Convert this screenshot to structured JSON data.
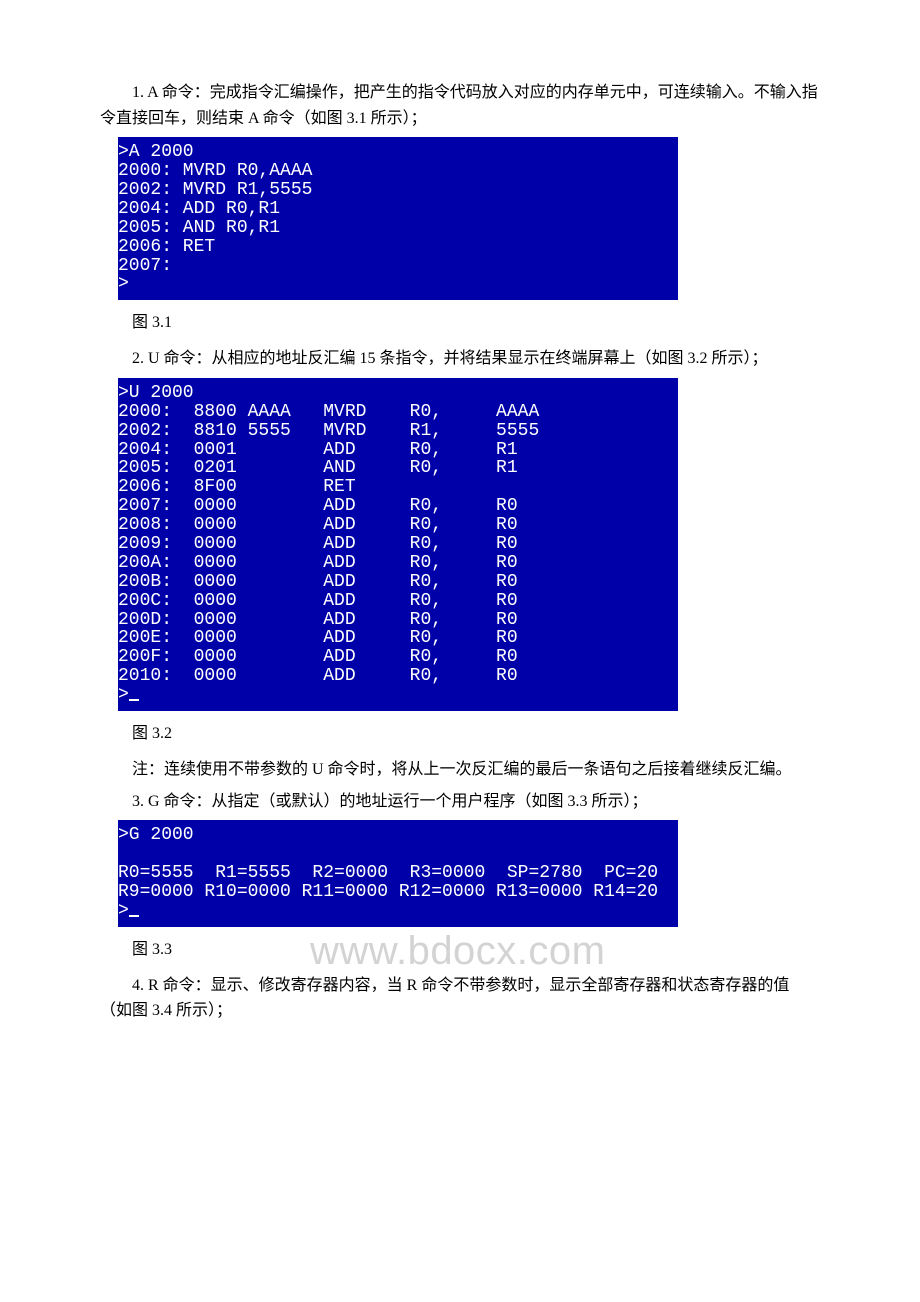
{
  "para1": "1. A 命令：完成指令汇编操作，把产生的指令代码放入对应的内存单元中，可连续输入。不输入指令直接回车，则结束 A 命令（如图 3.1 所示）；",
  "term1": {
    "lines": [
      ">A 2000",
      "2000: MVRD R0,AAAA",
      "2002: MVRD R1,5555",
      "2004: ADD R0,R1",
      "2005: AND R0,R1",
      "2006: RET",
      "2007:",
      ">"
    ]
  },
  "caption1": "图 3.1",
  "para2": "2. U 命令：从相应的地址反汇编 15 条指令，并将结果显示在终端屏幕上（如图 3.2 所示）；",
  "term2": {
    "rows": [
      {
        "content": ">U 2000"
      },
      {
        "addr": "2000:",
        "hex": "8800 AAAA",
        "op": "MVRD",
        "rd": "R0,",
        "rs": "AAAA"
      },
      {
        "addr": "2002:",
        "hex": "8810 5555",
        "op": "MVRD",
        "rd": "R1,",
        "rs": "5555"
      },
      {
        "addr": "2004:",
        "hex": "0001",
        "op": "ADD",
        "rd": "R0,",
        "rs": "R1"
      },
      {
        "addr": "2005:",
        "hex": "0201",
        "op": "AND",
        "rd": "R0,",
        "rs": "R1"
      },
      {
        "addr": "2006:",
        "hex": "8F00",
        "op": "RET",
        "rd": "",
        "rs": ""
      },
      {
        "addr": "2007:",
        "hex": "0000",
        "op": "ADD",
        "rd": "R0,",
        "rs": "R0"
      },
      {
        "addr": "2008:",
        "hex": "0000",
        "op": "ADD",
        "rd": "R0,",
        "rs": "R0"
      },
      {
        "addr": "2009:",
        "hex": "0000",
        "op": "ADD",
        "rd": "R0,",
        "rs": "R0"
      },
      {
        "addr": "200A:",
        "hex": "0000",
        "op": "ADD",
        "rd": "R0,",
        "rs": "R0"
      },
      {
        "addr": "200B:",
        "hex": "0000",
        "op": "ADD",
        "rd": "R0,",
        "rs": "R0"
      },
      {
        "addr": "200C:",
        "hex": "0000",
        "op": "ADD",
        "rd": "R0,",
        "rs": "R0"
      },
      {
        "addr": "200D:",
        "hex": "0000",
        "op": "ADD",
        "rd": "R0,",
        "rs": "R0"
      },
      {
        "addr": "200E:",
        "hex": "0000",
        "op": "ADD",
        "rd": "R0,",
        "rs": "R0"
      },
      {
        "addr": "200F:",
        "hex": "0000",
        "op": "ADD",
        "rd": "R0,",
        "rs": "R0"
      },
      {
        "addr": "2010:",
        "hex": "0000",
        "op": "ADD",
        "rd": "R0,",
        "rs": "R0"
      },
      {
        "content": ">_"
      }
    ]
  },
  "watermark": "www.bdocx.com",
  "caption2": "图 3.2",
  "para3": "注：连续使用不带参数的 U 命令时，将从上一次反汇编的最后一条语句之后接着继续反汇编。",
  "para4": "3. G 命令：从指定（或默认）的地址运行一个用户程序（如图 3.3 所示）；",
  "term3": {
    "lines": [
      ">G 2000",
      "",
      "R0=5555  R1=5555  R2=0000  R3=0000  SP=2780  PC=20",
      "R9=0000 R10=0000 R11=0000 R12=0000 R13=0000 R14=20",
      ">_"
    ]
  },
  "caption3": "图 3.3",
  "para5": "4. R 命令：显示、修改寄存器内容，当 R 命令不带参数时，显示全部寄存器和状态寄存器的值（如图 3.4 所示）；"
}
